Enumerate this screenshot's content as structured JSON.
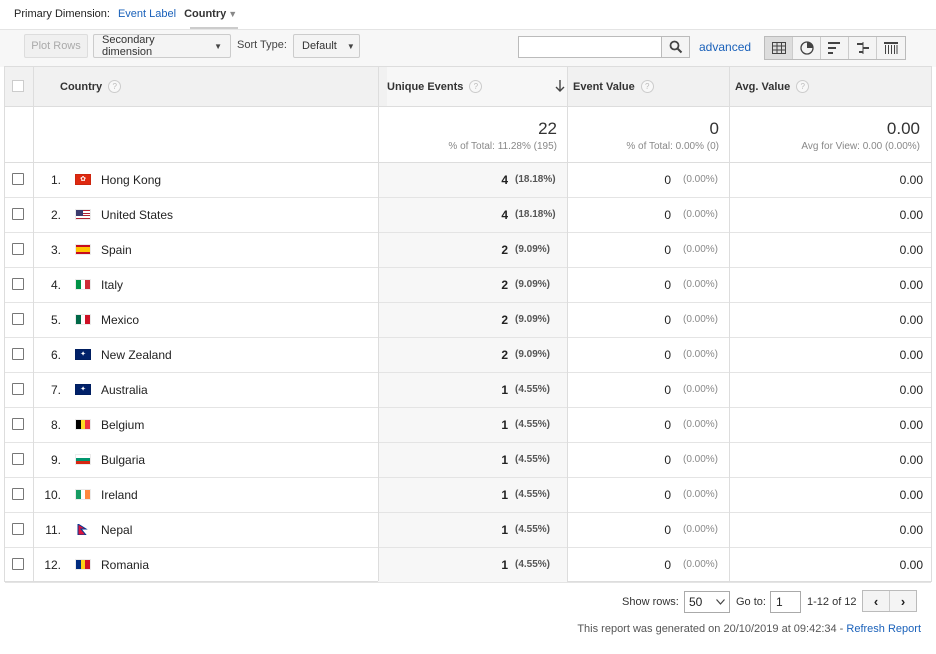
{
  "primary_dimension": {
    "label": "Primary Dimension:",
    "options": [
      "Event Label",
      "Country"
    ],
    "active": "Country"
  },
  "toolbar": {
    "plot_rows": "Plot Rows",
    "secondary_dimension": "Secondary dimension",
    "sort_type_label": "Sort Type:",
    "sort_type_value": "Default",
    "search_placeholder": "",
    "advanced": "advanced"
  },
  "table": {
    "headers": {
      "country": "Country",
      "unique_events": "Unique Events",
      "event_value": "Event Value",
      "avg_value": "Avg. Value"
    },
    "totals": {
      "unique_events": "22",
      "unique_events_sub": "% of Total: 11.28% (195)",
      "event_value": "0",
      "event_value_sub": "% of Total: 0.00% (0)",
      "avg_value": "0.00",
      "avg_value_sub": "Avg for View: 0.00 (0.00%)"
    },
    "rows": [
      {
        "index": "1.",
        "country": "Hong Kong",
        "flag": "hk",
        "ue": "4",
        "ue_pct": "(18.18%)",
        "ev": "0",
        "ev_pct": "(0.00%)",
        "avg": "0.00"
      },
      {
        "index": "2.",
        "country": "United States",
        "flag": "us",
        "ue": "4",
        "ue_pct": "(18.18%)",
        "ev": "0",
        "ev_pct": "(0.00%)",
        "avg": "0.00"
      },
      {
        "index": "3.",
        "country": "Spain",
        "flag": "es",
        "ue": "2",
        "ue_pct": "(9.09%)",
        "ev": "0",
        "ev_pct": "(0.00%)",
        "avg": "0.00"
      },
      {
        "index": "4.",
        "country": "Italy",
        "flag": "it",
        "ue": "2",
        "ue_pct": "(9.09%)",
        "ev": "0",
        "ev_pct": "(0.00%)",
        "avg": "0.00"
      },
      {
        "index": "5.",
        "country": "Mexico",
        "flag": "mx",
        "ue": "2",
        "ue_pct": "(9.09%)",
        "ev": "0",
        "ev_pct": "(0.00%)",
        "avg": "0.00"
      },
      {
        "index": "6.",
        "country": "New Zealand",
        "flag": "nz",
        "ue": "2",
        "ue_pct": "(9.09%)",
        "ev": "0",
        "ev_pct": "(0.00%)",
        "avg": "0.00"
      },
      {
        "index": "7.",
        "country": "Australia",
        "flag": "au",
        "ue": "1",
        "ue_pct": "(4.55%)",
        "ev": "0",
        "ev_pct": "(0.00%)",
        "avg": "0.00"
      },
      {
        "index": "8.",
        "country": "Belgium",
        "flag": "be",
        "ue": "1",
        "ue_pct": "(4.55%)",
        "ev": "0",
        "ev_pct": "(0.00%)",
        "avg": "0.00"
      },
      {
        "index": "9.",
        "country": "Bulgaria",
        "flag": "bg",
        "ue": "1",
        "ue_pct": "(4.55%)",
        "ev": "0",
        "ev_pct": "(0.00%)",
        "avg": "0.00"
      },
      {
        "index": "10.",
        "country": "Ireland",
        "flag": "ie",
        "ue": "1",
        "ue_pct": "(4.55%)",
        "ev": "0",
        "ev_pct": "(0.00%)",
        "avg": "0.00"
      },
      {
        "index": "11.",
        "country": "Nepal",
        "flag": "np",
        "ue": "1",
        "ue_pct": "(4.55%)",
        "ev": "0",
        "ev_pct": "(0.00%)",
        "avg": "0.00"
      },
      {
        "index": "12.",
        "country": "Romania",
        "flag": "ro",
        "ue": "1",
        "ue_pct": "(4.55%)",
        "ev": "0",
        "ev_pct": "(0.00%)",
        "avg": "0.00"
      }
    ]
  },
  "footer": {
    "show_rows_label": "Show rows:",
    "show_rows_value": "50",
    "goto_label": "Go to:",
    "goto_value": "1",
    "range": "1-12 of 12",
    "generated": "This report was generated on 20/10/2019 at 09:42:34 -",
    "refresh": "Refresh Report"
  },
  "colors": {
    "link": "#1a61ba",
    "header_bg": "#f1f1f1",
    "border": "#dddddd"
  },
  "icons": {
    "search": "search-icon",
    "sort": "arrow-down-icon",
    "help": "help-icon",
    "prev": "chevron-left-icon",
    "next": "chevron-right-icon"
  }
}
